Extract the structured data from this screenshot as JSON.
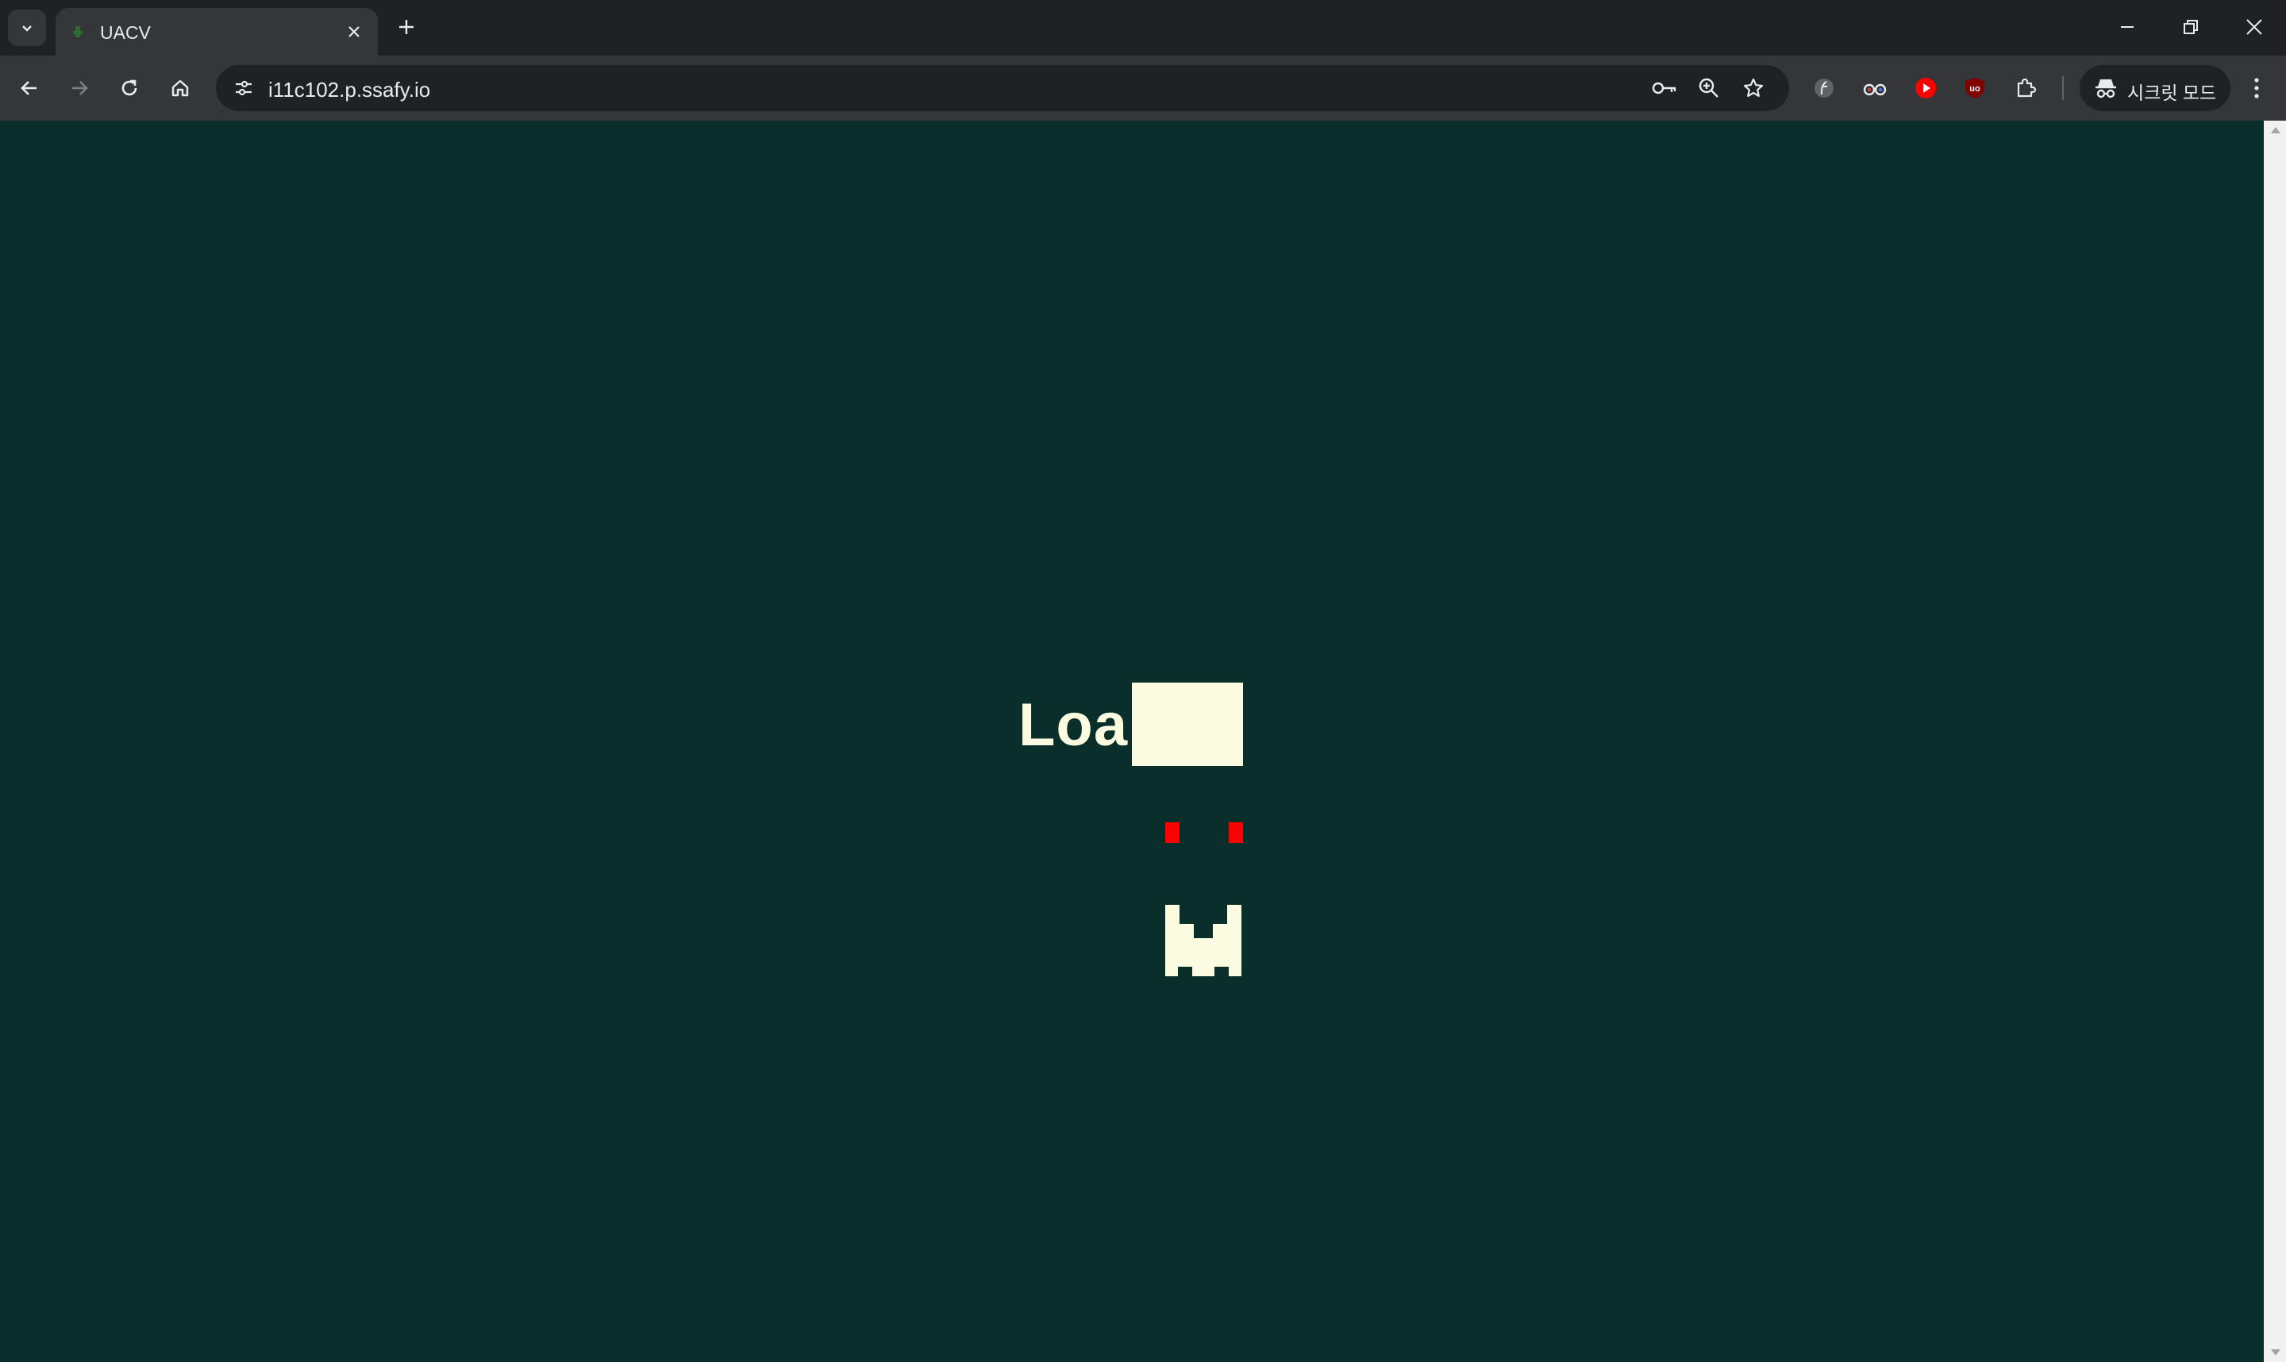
{
  "browser": {
    "tab_title": "UACV",
    "url": "i11c102.p.ssafy.io",
    "incognito_label": "시크릿 모드"
  },
  "icons": {
    "tab_search": "chevron-down-icon",
    "tab_close": "close-icon",
    "new_tab": "plus-icon",
    "minimize": "minimize-icon",
    "restore": "restore-icon",
    "close_window": "close-icon",
    "back": "arrow-left-icon",
    "forward": "arrow-right-icon",
    "reload": "reload-icon",
    "home": "home-icon",
    "site_info": "tune-icon",
    "password": "key-icon",
    "zoom": "zoom-in-icon",
    "bookmark": "star-icon",
    "extensions": [
      "feather-extension-icon",
      "glasses-extension-icon",
      "youtube-extension-icon",
      "ublock-extension-icon",
      "puzzle-icon"
    ],
    "incognito": "incognito-icon",
    "menu": "kebab-menu-icon"
  },
  "page": {
    "loading_text": "Loa",
    "background_color": "#0a2e2a",
    "text_color": "#fbfbe2",
    "accent_color": "#ff0000"
  }
}
